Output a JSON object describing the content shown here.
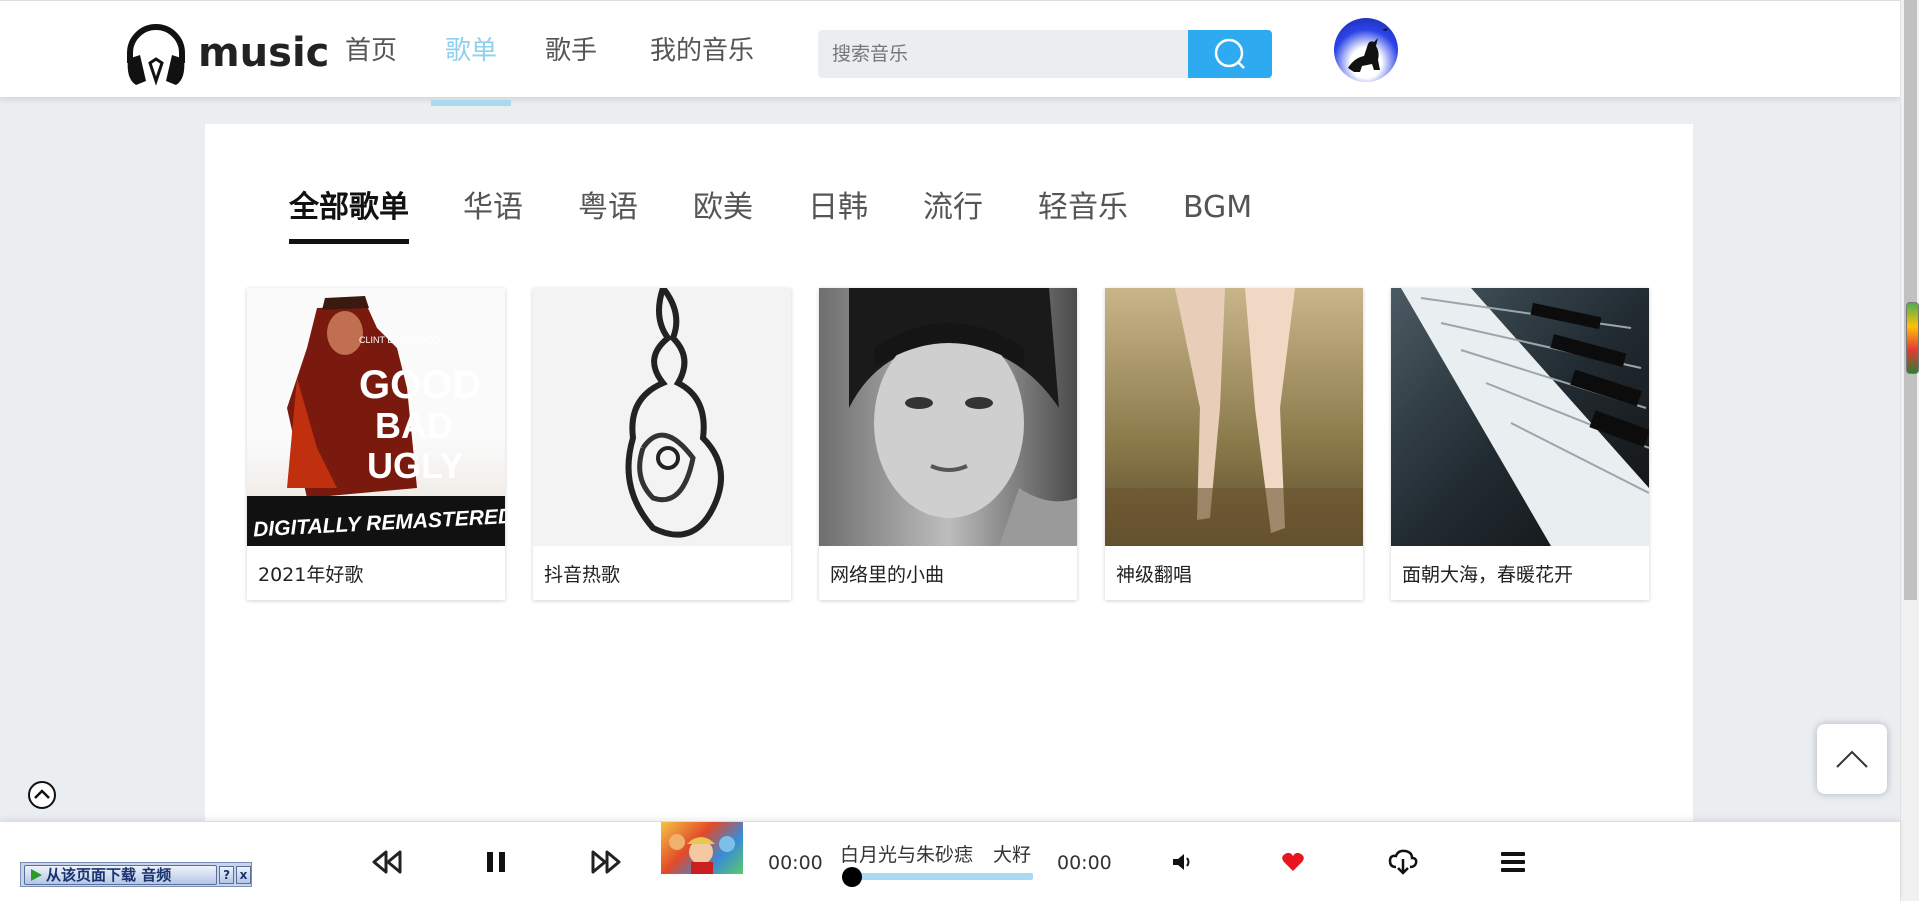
{
  "header": {
    "logo_text": "music",
    "nav": [
      {
        "label": "首页",
        "active": false
      },
      {
        "label": "歌单",
        "active": true
      },
      {
        "label": "歌手",
        "active": false
      },
      {
        "label": "我的音乐",
        "active": false
      }
    ],
    "search": {
      "placeholder": "搜索音乐",
      "value": ""
    },
    "accent_color": "#2eaaf0",
    "active_nav_color": "#8fd0f0"
  },
  "categories": {
    "tabs": [
      "全部歌单",
      "华语",
      "粤语",
      "欧美",
      "日韩",
      "流行",
      "轻音乐",
      "BGM"
    ],
    "active": "全部歌单"
  },
  "playlists": [
    {
      "title": "2021年好歌",
      "cover_banner": "DIGITALLY REMASTERED",
      "cover_lines": [
        "GOOD",
        "BAD",
        "UGLY"
      ]
    },
    {
      "title": "抖音热歌"
    },
    {
      "title": "网络里的小曲"
    },
    {
      "title": "神级翻唱"
    },
    {
      "title": "面朝大海，春暖花开"
    }
  ],
  "player": {
    "current_time": "00:00",
    "duration": "00:00",
    "song": "白月光与朱砂痣",
    "artist": "大籽",
    "progress": 0,
    "liked_color": "#e8141e",
    "icons": [
      "rewind-icon",
      "pause-icon",
      "fast-forward-icon",
      "volume-icon",
      "heart-icon",
      "cloud-download-icon",
      "menu-icon"
    ]
  },
  "download_extension": {
    "label": "从该页面下载 音频",
    "help": "?",
    "close": "x"
  }
}
